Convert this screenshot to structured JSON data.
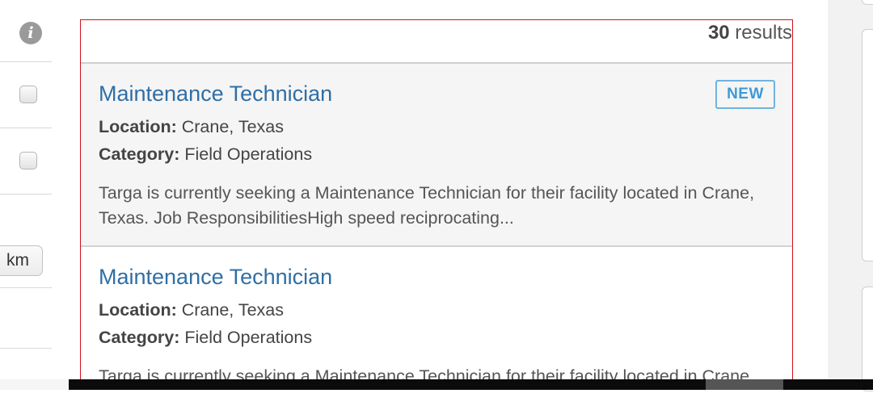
{
  "results": {
    "count": "30",
    "suffix": " results"
  },
  "filters": {
    "distance_unit": "km"
  },
  "jobs": [
    {
      "title": "Maintenance Technician",
      "badge": "NEW",
      "location_label": "Location:",
      "location": " Crane, Texas",
      "category_label": "Category:",
      "category": " Field Operations",
      "description": "Targa is currently seeking a Maintenance Technician for their facility located in Crane, Texas. Job ResponsibilitiesHigh speed reciprocating..."
    },
    {
      "title": "Maintenance Technician",
      "location_label": "Location:",
      "location": " Crane, Texas",
      "category_label": "Category:",
      "category": " Field Operations",
      "description": "Targa is currently seeking a Maintenance Technician for their facility located in Crane, Texas. Job ResponsibilitiesHigh speed reciprocating..."
    }
  ],
  "icons": {
    "info": "info-icon"
  },
  "colors": {
    "link": "#2f6fa5",
    "badge": "#3d9ad6",
    "panel_border": "#d0121b"
  }
}
